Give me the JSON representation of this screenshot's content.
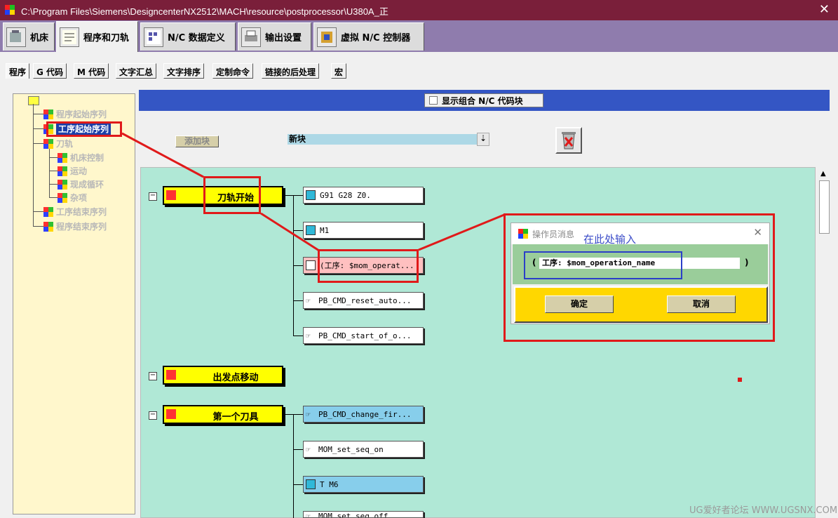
{
  "window": {
    "title": "C:\\Program Files\\Siemens\\DesigncenterNX2512\\MACH\\resource\\postprocessor\\U380A_正",
    "close_glyph": "✕"
  },
  "main_tabs": [
    {
      "label": "机床",
      "icon": "machine-icon"
    },
    {
      "label": "程序和刀轨",
      "icon": "program-icon",
      "active": true
    },
    {
      "label": "N/C 数据定义",
      "icon": "nc-data-icon"
    },
    {
      "label": "输出设置",
      "icon": "printer-icon"
    },
    {
      "label": "虚拟 N/C 控制器",
      "icon": "virtual-controller-icon"
    }
  ],
  "sub_tabs": [
    {
      "label": "程序",
      "active": true
    },
    {
      "label": "G 代码"
    },
    {
      "label": "M 代码"
    },
    {
      "label": "文字汇总"
    },
    {
      "label": "文字排序"
    },
    {
      "label": "定制命令"
    },
    {
      "label": "链接的后处理"
    },
    {
      "label": "宏"
    }
  ],
  "tree": {
    "items": [
      {
        "label": "程序起始序列"
      },
      {
        "label": "工序起始序列",
        "selected": true
      },
      {
        "label": "刀轨"
      },
      {
        "label": "机床控制"
      },
      {
        "label": "运动"
      },
      {
        "label": "现成循环"
      },
      {
        "label": "杂项"
      },
      {
        "label": "工序结束序列"
      },
      {
        "label": "程序结束序列"
      }
    ]
  },
  "toolbar": {
    "show_combined_label": "显示组合 N/C 代码块",
    "add_block_label": "添加块",
    "new_block_value": "新块",
    "dropdown_glyph": "⇣"
  },
  "events": [
    {
      "label": "刀轨开始",
      "blocks": [
        {
          "text": "G91 G28 Z0.",
          "style": "white",
          "icon": "block-cube-icon"
        },
        {
          "text": "M1",
          "style": "white",
          "icon": "block-cube-icon"
        },
        {
          "text": "(工序: $mom_operat...",
          "style": "pink",
          "icon": "document-icon"
        },
        {
          "text": "PB_CMD_reset_auto...",
          "style": "white",
          "icon": "hand-pointer-icon"
        },
        {
          "text": "PB_CMD_start_of_o...",
          "style": "white",
          "icon": "hand-pointer-icon"
        }
      ]
    },
    {
      "label": "出发点移动",
      "blocks": []
    },
    {
      "label": "第一个刀具",
      "blocks": [
        {
          "text": "PB_CMD_change_fir...",
          "style": "blue",
          "icon": "hand-pointer-icon"
        },
        {
          "text": "MOM_set_seq_on",
          "style": "white",
          "icon": "hand-pointer-icon"
        },
        {
          "text": "T M6",
          "style": "blue",
          "icon": "block-cube-icon"
        },
        {
          "text": "MOM_set_seq_off",
          "style": "white",
          "icon": "hand-pointer-icon"
        }
      ]
    }
  ],
  "dialog": {
    "title": "操作员消息",
    "close_glyph": "✕",
    "open_paren": "(",
    "close_paren": ")",
    "field_value": "工序: $mom_operation_name",
    "ok_label": "确定",
    "cancel_label": "取消"
  },
  "annotation": {
    "text": "在此处输入"
  },
  "watermark": "UG爱好者论坛 WWW.UGSNX.COM",
  "colors": {
    "title_bar": "#7a1f3a",
    "tab_bar": "#8f7cad",
    "canvas": "#b0e8d6",
    "event_yellow": "#ffff00",
    "annotation_red": "#e01a1a"
  }
}
